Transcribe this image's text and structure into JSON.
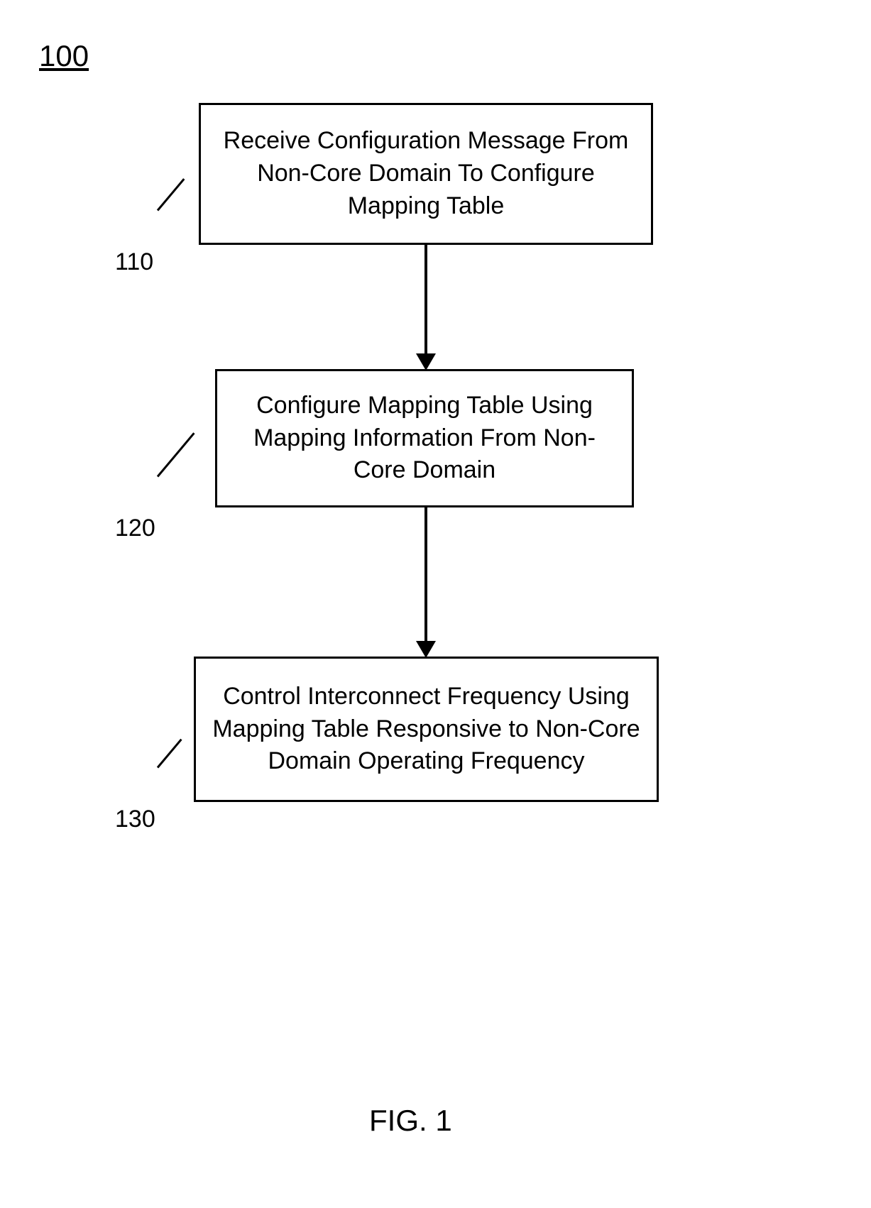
{
  "title": "100",
  "boxes": {
    "box1": "Receive Configuration Message From Non-Core Domain To Configure Mapping Table",
    "box2": "Configure Mapping Table Using Mapping Information From Non-Core Domain",
    "box3": "Control Interconnect Frequency Using Mapping Table Responsive to Non-Core Domain Operating Frequency"
  },
  "labels": {
    "label1": "110",
    "label2": "120",
    "label3": "130"
  },
  "figure_caption": "FIG. 1",
  "chart_data": {
    "type": "flowchart",
    "title": "100",
    "nodes": [
      {
        "id": "110",
        "text": "Receive Configuration Message From Non-Core Domain To Configure Mapping Table"
      },
      {
        "id": "120",
        "text": "Configure Mapping Table Using Mapping Information From Non-Core Domain"
      },
      {
        "id": "130",
        "text": "Control Interconnect Frequency Using Mapping Table Responsive to Non-Core Domain Operating Frequency"
      }
    ],
    "edges": [
      {
        "from": "110",
        "to": "120"
      },
      {
        "from": "120",
        "to": "130"
      }
    ],
    "caption": "FIG. 1"
  }
}
